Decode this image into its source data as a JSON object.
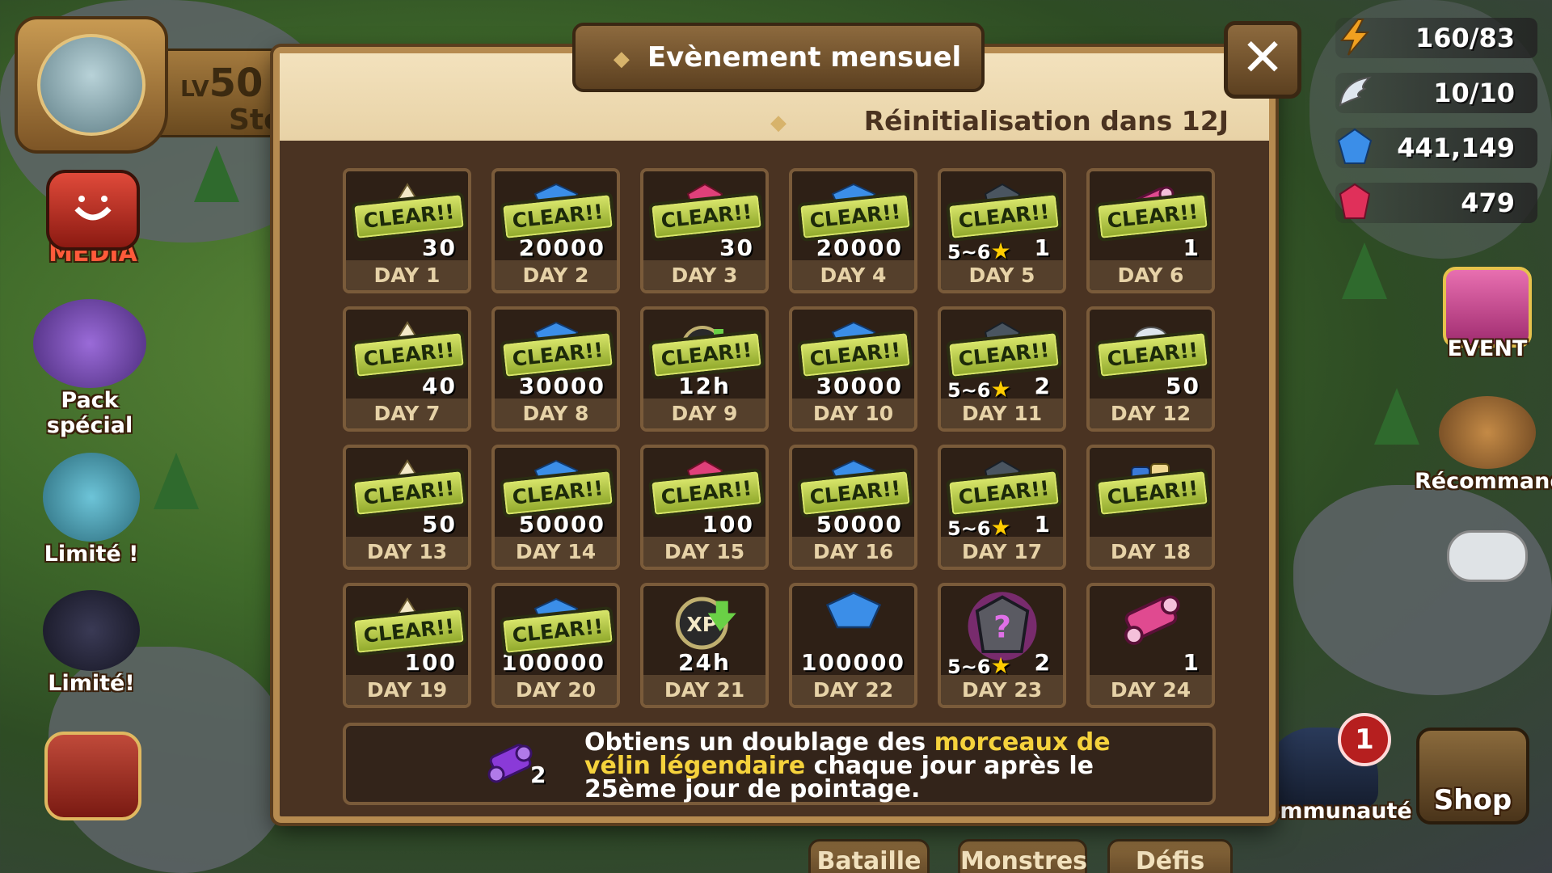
{
  "profile": {
    "level_prefix": "LV",
    "level": "50",
    "name": "Ste"
  },
  "left_menu": {
    "media": "MEDIA",
    "pack": "Pack spécial",
    "limited1": "Limité !",
    "limited2": "Limité!"
  },
  "resources": [
    {
      "icon": "lightning-icon",
      "value": "160/83"
    },
    {
      "icon": "wing-icon",
      "value": "10/10"
    },
    {
      "icon": "crystal-icon",
      "value": "441,149"
    },
    {
      "icon": "ruby-icon",
      "value": "479"
    }
  ],
  "right_menu": {
    "event": "EVENT",
    "recommended": "Récommandé"
  },
  "bottom_tabs": [
    "Bataille",
    "Monstres",
    "Défis",
    "Communauté",
    "Shop"
  ],
  "notification_count": "1",
  "modal": {
    "title": "Evènement mensuel",
    "reset": "Réinitialisation dans 12J",
    "close_label": "✕",
    "cells": [
      {
        "day": "DAY 1",
        "qty": "30",
        "cleared": true,
        "icon": "energy-icon"
      },
      {
        "day": "DAY 2",
        "qty": "20000",
        "cleared": true,
        "icon": "mana-crystal-icon"
      },
      {
        "day": "DAY 3",
        "qty": "30",
        "cleared": true,
        "icon": "crystal-icon"
      },
      {
        "day": "DAY 4",
        "qty": "20000",
        "cleared": true,
        "icon": "mana-crystal-icon"
      },
      {
        "day": "DAY 5",
        "qty": "1",
        "stars": "5~6",
        "cleared": true,
        "icon": "rune-icon"
      },
      {
        "day": "DAY 6",
        "qty": "1",
        "cleared": true,
        "icon": "scroll-icon"
      },
      {
        "day": "DAY 7",
        "qty": "40",
        "cleared": true,
        "icon": "energy-icon"
      },
      {
        "day": "DAY 8",
        "qty": "30000",
        "cleared": true,
        "icon": "mana-crystal-icon"
      },
      {
        "day": "DAY 9",
        "qty": "12h",
        "cleared": true,
        "icon": "xp-boost-icon"
      },
      {
        "day": "DAY 10",
        "qty": "30000",
        "cleared": true,
        "icon": "mana-crystal-icon"
      },
      {
        "day": "DAY 11",
        "qty": "2",
        "stars": "5~6",
        "cleared": true,
        "icon": "rune-icon"
      },
      {
        "day": "DAY 12",
        "qty": "50",
        "cleared": true,
        "icon": "essence-icon"
      },
      {
        "day": "DAY 13",
        "qty": "50",
        "cleared": true,
        "icon": "energy-icon"
      },
      {
        "day": "DAY 14",
        "qty": "50000",
        "cleared": true,
        "icon": "mana-crystal-icon"
      },
      {
        "day": "DAY 15",
        "qty": "100",
        "cleared": true,
        "icon": "crystal-icon"
      },
      {
        "day": "DAY 16",
        "qty": "50000",
        "cleared": true,
        "icon": "mana-crystal-icon"
      },
      {
        "day": "DAY 17",
        "qty": "1",
        "stars": "5~6",
        "cleared": true,
        "icon": "rune-icon"
      },
      {
        "day": "DAY 18",
        "qty": "",
        "cleared": true,
        "icon": "scroll-pack-icon"
      },
      {
        "day": "DAY 19",
        "qty": "100",
        "cleared": true,
        "icon": "energy-icon"
      },
      {
        "day": "DAY 20",
        "qty": "100000",
        "cleared": true,
        "icon": "mana-crystal-icon"
      },
      {
        "day": "DAY 21",
        "qty": "24h",
        "cleared": false,
        "icon": "xp-boost-icon"
      },
      {
        "day": "DAY 22",
        "qty": "100000",
        "cleared": false,
        "icon": "mana-crystal-icon"
      },
      {
        "day": "DAY 23",
        "qty": "2",
        "stars": "5~6",
        "cleared": false,
        "icon": "mystery-rune-icon"
      },
      {
        "day": "DAY 24",
        "qty": "1",
        "cleared": false,
        "icon": "scroll-icon"
      }
    ],
    "clear_label": "CLEAR!!",
    "footer": {
      "qty": "2",
      "t1": "Obtiens un ",
      "t2": "doublage",
      "t3": " des ",
      "t4": "morceaux de vélin légendaire",
      "t5": " chaque jour après le 25ème jour de pointage."
    }
  },
  "colors": {
    "modal_bg": "#4a3322",
    "header_bg": "#f3e2bd",
    "clear_green": "#b9cc47",
    "highlight_yellow": "#f5d23c"
  }
}
